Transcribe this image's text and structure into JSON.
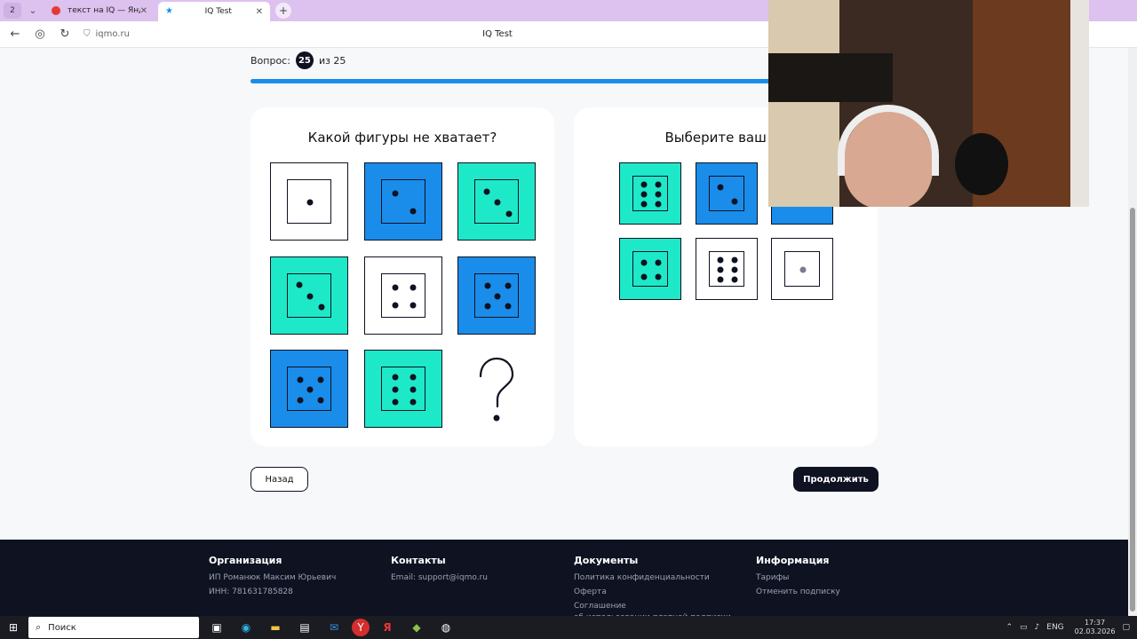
{
  "browser": {
    "tab_counter": "2",
    "tabs": [
      {
        "title": "текст на IQ — Яндекс: нал"
      },
      {
        "title": "IQ Test"
      }
    ],
    "url": "iqmo.ru",
    "page_title": "IQ Test"
  },
  "quiz": {
    "question_label": "Вопрос:",
    "current": "25",
    "total_label": "из 25",
    "progress_fraction": 1.0
  },
  "puzzle": {
    "title": "Какой фигуры не хватает?",
    "grid": [
      {
        "bg": "white",
        "pips": 1
      },
      {
        "bg": "blue",
        "pips": 2
      },
      {
        "bg": "teal",
        "pips": 3
      },
      {
        "bg": "teal",
        "pips": 3
      },
      {
        "bg": "white",
        "pips": 4
      },
      {
        "bg": "blue",
        "pips": 5
      },
      {
        "bg": "blue",
        "pips": 5
      },
      {
        "bg": "teal",
        "pips": 6
      },
      {
        "bg": "missing",
        "pips": 0
      }
    ],
    "missing_symbol": "?"
  },
  "answers": {
    "title": "Выберите ваш от",
    "options": [
      {
        "bg": "teal",
        "pips": 6
      },
      {
        "bg": "blue",
        "pips": 2
      },
      {
        "bg": "blue",
        "pips": 0
      },
      {
        "bg": "teal",
        "pips": 4
      },
      {
        "bg": "white",
        "pips": 6
      },
      {
        "bg": "white",
        "pips": 1
      }
    ]
  },
  "buttons": {
    "back": "Назад",
    "next": "Продолжить"
  },
  "footer": {
    "org": {
      "heading": "Организация",
      "lines": [
        "ИП Романюк Максим Юрьевич",
        "ИНН: 781631785828"
      ]
    },
    "contacts": {
      "heading": "Контакты",
      "lines": [
        "Email: support@iqmo.ru"
      ]
    },
    "docs": {
      "heading": "Документы",
      "lines": [
        "Политика конфиденциальности",
        "Оферта",
        "Соглашение",
        "об использовании платной подписки"
      ]
    },
    "info": {
      "heading": "Информация",
      "lines": [
        "Тарифы",
        "Отменить подписку"
      ]
    }
  },
  "taskbar": {
    "search_label": "Поиск",
    "lang": "ENG",
    "time": "17:37",
    "date": "02.03.2026"
  },
  "colors": {
    "blue": "#1a8dea",
    "teal": "#1de9c9",
    "dark": "#0f1221"
  }
}
